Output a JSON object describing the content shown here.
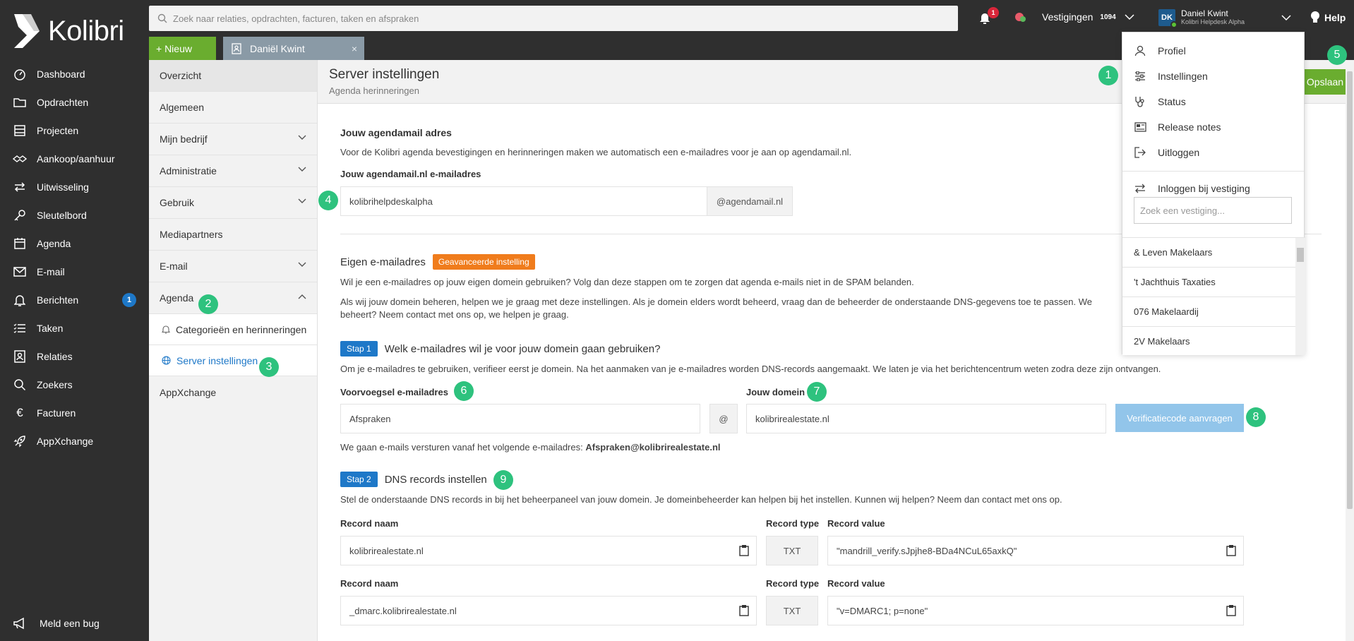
{
  "app": {
    "name": "Kolibri"
  },
  "sidebar": {
    "items": [
      {
        "label": "Dashboard",
        "icon": "dashboard-icon"
      },
      {
        "label": "Opdrachten",
        "icon": "folder-icon"
      },
      {
        "label": "Projecten",
        "icon": "projects-icon"
      },
      {
        "label": "Aankoop/aanhuur",
        "icon": "handshake-icon"
      },
      {
        "label": "Uitwisseling",
        "icon": "exchange-icon"
      },
      {
        "label": "Sleutelbord",
        "icon": "key-icon"
      },
      {
        "label": "Agenda",
        "icon": "calendar-icon"
      },
      {
        "label": "E-mail",
        "icon": "mail-icon"
      },
      {
        "label": "Berichten",
        "icon": "bell-icon",
        "badge": "1"
      },
      {
        "label": "Taken",
        "icon": "tasks-icon"
      },
      {
        "label": "Relaties",
        "icon": "contacts-icon"
      },
      {
        "label": "Zoekers",
        "icon": "search-icon"
      },
      {
        "label": "Facturen",
        "icon": "euro-icon"
      },
      {
        "label": "AppXchange",
        "icon": "rocket-icon"
      }
    ],
    "bug_label": "Meld een bug"
  },
  "topbar": {
    "search_placeholder": "Zoek naar relaties, opdrachten, facturen, taken en afspraken",
    "notifications_count": "1",
    "vestigingen_label": "Vestigingen",
    "vestigingen_count": "1094",
    "user_initials": "DK",
    "user_name": "Daniel Kwint",
    "user_org": "Kolibri Helpdesk Alpha",
    "help_label": "Help"
  },
  "tabs": {
    "new_label": "+ Nieuw",
    "open_tab": "Daniël Kwint",
    "close": "×"
  },
  "subnav": {
    "items": [
      {
        "label": "Overzicht"
      },
      {
        "label": "Algemeen"
      },
      {
        "label": "Mijn bedrijf"
      },
      {
        "label": "Administratie"
      },
      {
        "label": "Gebruik"
      },
      {
        "label": "Mediapartners"
      },
      {
        "label": "E-mail"
      },
      {
        "label": "Agenda"
      }
    ],
    "agenda_children": [
      {
        "label": "Categorieën en herinneringen"
      },
      {
        "label": "Server instellingen"
      }
    ],
    "appxchange": "AppXchange"
  },
  "page": {
    "title": "Server instellingen",
    "subtitle": "Agenda herinneringen",
    "save_label": "Opslaan"
  },
  "agendamail": {
    "heading": "Jouw agendamail adres",
    "desc": "Voor de Kolibri agenda bevestigingen en herinneringen maken we automatisch een e-mailadres voor je aan op agendamail.nl.",
    "field_label": "Jouw agendamail.nl e-mailadres",
    "value": "kolibrihelpdeskalpha",
    "suffix": "@agendamail.nl"
  },
  "own": {
    "heading": "Eigen e-mailadres",
    "badge": "Geavanceerde instelling",
    "p1": "Wil je een e-mailadres op jouw eigen domein gebruiken? Volg dan deze stappen om te zorgen dat agenda e-mails niet in de SPAM belanden.",
    "p2a": "Als wij jouw domein beheren, helpen we je graag met deze instellingen. Als je domein elders wordt beheerd, vraag dan de beheerder de onderstaande DNS-gegevens toe te passen. We",
    "p2b": "beheert? Neem contact met ons op, we helpen je graag."
  },
  "step1": {
    "badge": "Stap 1",
    "title": "Welk e-mailadres wil je voor jouw domein gaan gebruiken?",
    "desc": "Om je e-mailadres te gebruiken, verifieer eerst je domein. Na het aanmaken van je e-mailadres worden DNS-records aangemaakt. We laten je via het berichtencentrum weten zodra deze zijn ontvangen.",
    "prefix_label": "Voorvoegsel e-mailadres",
    "prefix_value": "Afspraken",
    "at": "@",
    "domain_label": "Jouw domein",
    "domain_value": "kolibrirealestate.nl",
    "verify_label": "Verificatiecode aanvragen",
    "send_text": "We gaan e-mails versturen vanaf het volgende e-mailadres:",
    "send_address": "Afspraken@kolibrirealestate.nl"
  },
  "step2": {
    "badge": "Stap 2",
    "title": "DNS records instellen",
    "desc": "Stel de onderstaande DNS records in bij het beheerpaneel van jouw domein. Je domeinbeheerder kan helpen bij het instellen. Kunnen wij helpen? Neem dan contact met ons op.",
    "records": [
      {
        "name_label": "Record naam",
        "name": "kolibrirealestate.nl",
        "type_label": "Record type",
        "type": "TXT",
        "value_label": "Record value",
        "value": "\"mandrill_verify.sJpjhe8-BDa4NCuL65axkQ\""
      },
      {
        "name_label": "Record naam",
        "name": "_dmarc.kolibrirealestate.nl",
        "type_label": "Record type",
        "type": "TXT",
        "value_label": "Record value",
        "value": "\"v=DMARC1; p=none\""
      }
    ]
  },
  "dropdown": {
    "items": [
      {
        "label": "Profiel",
        "icon": "user-icon"
      },
      {
        "label": "Instellingen",
        "icon": "sliders-icon"
      },
      {
        "label": "Status",
        "icon": "stethoscope-icon"
      },
      {
        "label": "Release notes",
        "icon": "newspaper-icon"
      },
      {
        "label": "Uitloggen",
        "icon": "logout-icon"
      }
    ],
    "login_branch": "Inloggen bij vestiging",
    "search_placeholder": "Zoek een vestiging...",
    "branches": [
      "& Leven Makelaars",
      "'t Jachthuis Taxaties",
      "076 Makelaardij",
      "2V Makelaars"
    ]
  },
  "markers": [
    "1",
    "2",
    "3",
    "4",
    "5",
    "6",
    "7",
    "8",
    "9"
  ],
  "colors": {
    "sidebar": "#2f2f2f",
    "accent_green": "#6aad2f",
    "marker_green": "#2ec27e",
    "blue": "#1e78c8",
    "orange": "#f07c1c",
    "badge_red": "#d9263a"
  }
}
